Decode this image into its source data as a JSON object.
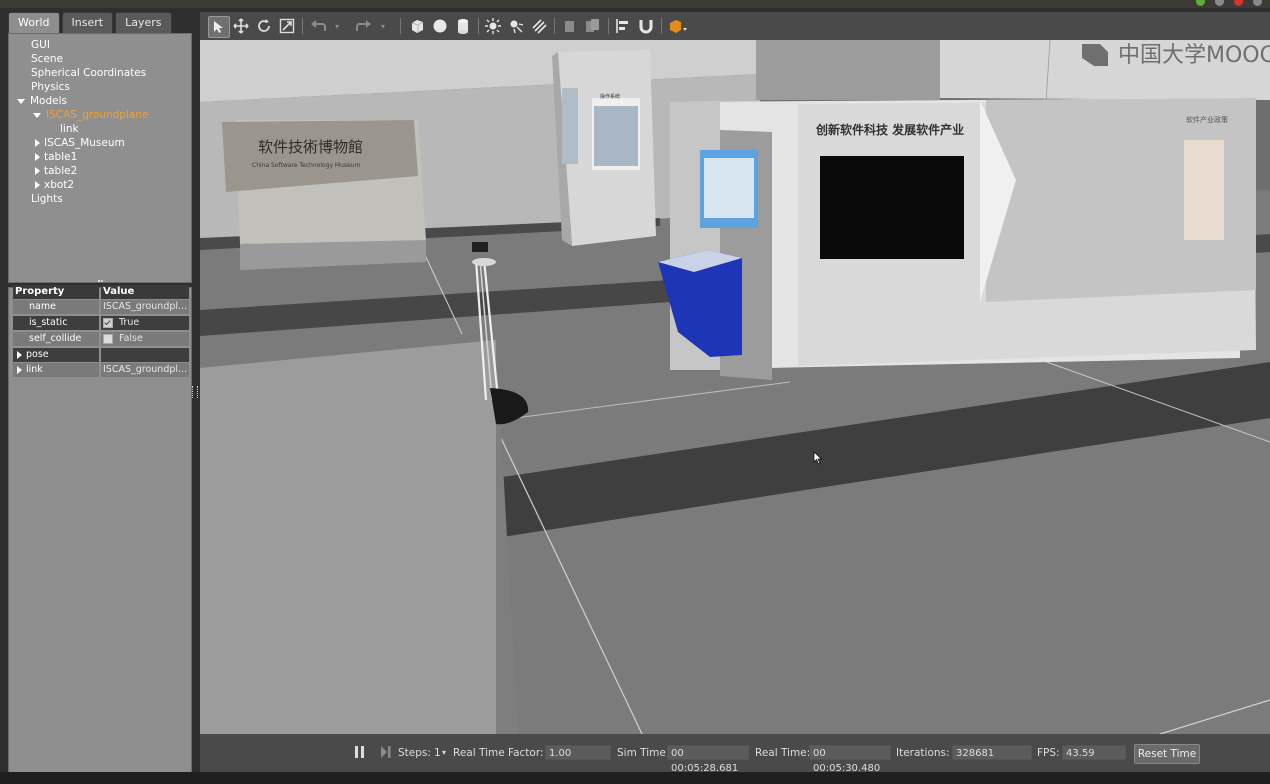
{
  "left_panel": {
    "tabs": [
      "World",
      "Insert",
      "Layers"
    ],
    "tree": {
      "items": [
        "GUI",
        "Scene",
        "Spherical Coordinates",
        "Physics"
      ],
      "models_label": "Models",
      "selected_model": "ISCAS_groundplane",
      "selected_child": "link",
      "other_models": [
        "ISCAS_Museum",
        "table1",
        "table2",
        "xbot2"
      ],
      "lights_label": "Lights"
    },
    "properties": {
      "header": {
        "property": "Property",
        "value": "Value"
      },
      "rows": [
        {
          "key": "name",
          "value": "ISCAS_groundpl..."
        },
        {
          "key": "is_static",
          "value": "True",
          "checked": true
        },
        {
          "key": "self_collide",
          "value": "False",
          "checked": false
        },
        {
          "key": "pose",
          "value": ""
        },
        {
          "key": "link",
          "value": "ISCAS_groundpl..."
        }
      ]
    }
  },
  "toolbar": {
    "icons": [
      "select-arrow-icon",
      "translate-icon",
      "rotate-icon",
      "scale-icon",
      "undo-icon",
      "redo-icon",
      "box-shape-icon",
      "sphere-shape-icon",
      "cylinder-shape-icon",
      "point-light-icon",
      "spot-light-icon",
      "directional-light-icon",
      "copy-icon",
      "paste-icon",
      "align-icon",
      "snap-magnet-icon",
      "view-angle-icon"
    ]
  },
  "viewport": {
    "watermark": "中国大学MOOC",
    "museum_sign": {
      "title": "软件技術博物館",
      "subtitle": "China Software Technology Museum"
    },
    "wall_heading": "创新软件科技 发展软件产业",
    "pillar_label": "操作系统",
    "wall_corner_label": "软件产业政策"
  },
  "bottom_bar": {
    "steps_label": "Steps:",
    "steps_value": "1",
    "real_time_factor_label": "Real Time Factor:",
    "real_time_factor_value": "1.00",
    "sim_time_label": "Sim Time:",
    "sim_time_value": "00 00:05:28.681",
    "real_time_label": "Real Time:",
    "real_time_value": "00 00:05:30.480",
    "iterations_label": "Iterations:",
    "iterations_value": "328681",
    "fps_label": "FPS:",
    "fps_value": "43.59",
    "reset_label": "Reset Time"
  },
  "colors": {
    "selected_text": "#f0a030",
    "panel_bg": "#8f8f8f",
    "toolbar_bg": "#4a4a4a",
    "floor": "#7a7a7a",
    "blue_kiosk": "#1f35b8"
  }
}
